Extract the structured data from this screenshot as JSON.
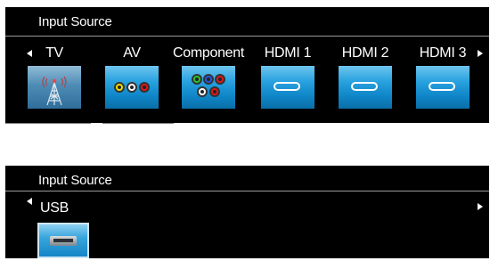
{
  "panel_top": {
    "title": "Input Source",
    "selected": "TV",
    "sources": [
      {
        "label": "TV",
        "icon": "antenna-icon"
      },
      {
        "label": "AV",
        "icon": "composite-jacks-icon"
      },
      {
        "label": "Component",
        "icon": "component-jacks-icon"
      },
      {
        "label": "HDMI 1",
        "icon": "hdmi-port-icon"
      },
      {
        "label": "HDMI 2",
        "icon": "hdmi-port-icon"
      },
      {
        "label": "HDMI 3",
        "icon": "hdmi-port-icon"
      }
    ]
  },
  "panel_bottom": {
    "title": "Input Source",
    "selected": "USB",
    "sources": [
      {
        "label": "USB",
        "icon": "usb-port-icon"
      }
    ]
  },
  "colors": {
    "panel_bg": "#000000",
    "tile_blue": "#1a94d6",
    "jack_yellow": "#f2e000",
    "jack_white": "#ffffff",
    "jack_red": "#e01818",
    "jack_green": "#2fc02f",
    "jack_blue": "#2a55d8"
  }
}
